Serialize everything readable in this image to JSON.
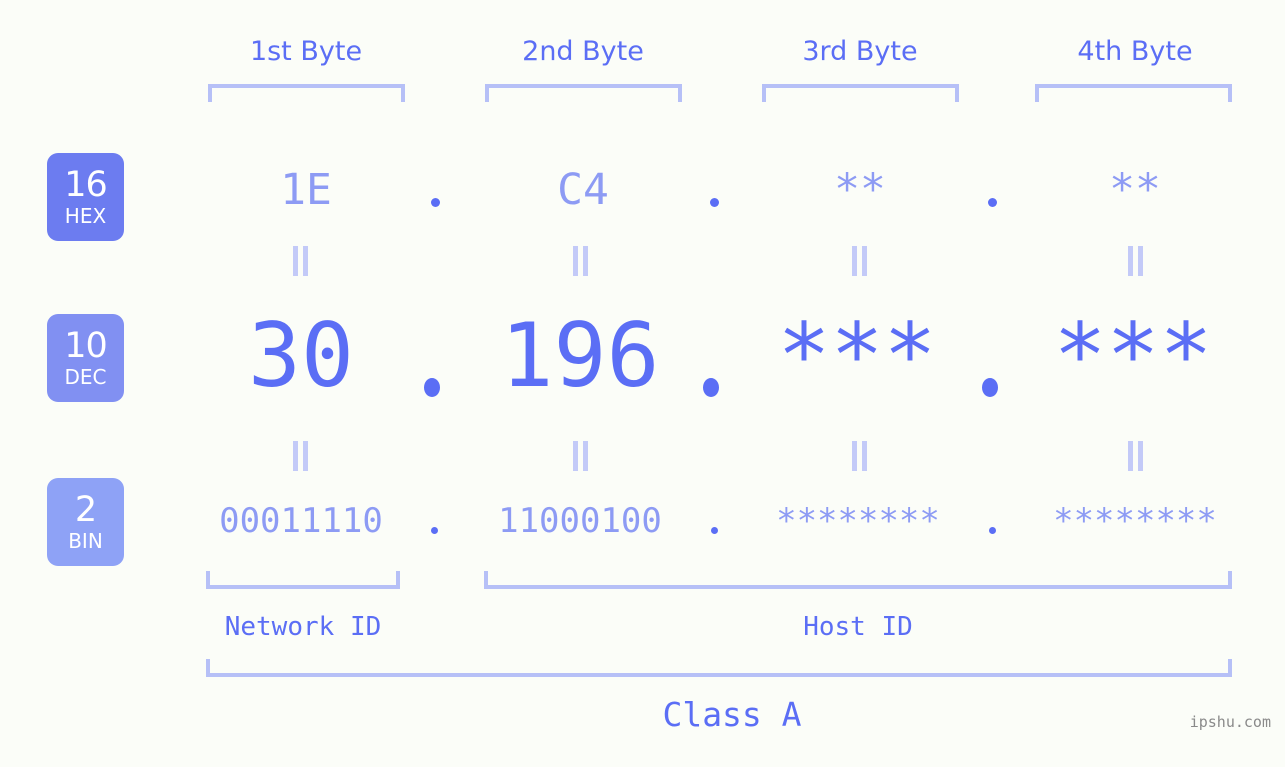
{
  "page": {
    "background_color": "#fbfdf8",
    "accent_color": "#5b6ef5",
    "muted_accent_color": "#8d9bf4",
    "bracket_color": "#b6c0f7",
    "watermark": "ipshu.com"
  },
  "byte_headers": [
    {
      "label": "1st Byte"
    },
    {
      "label": "2nd Byte"
    },
    {
      "label": "3rd Byte"
    },
    {
      "label": "4th Byte"
    }
  ],
  "rows": [
    {
      "badge": {
        "number": "16",
        "name": "HEX",
        "color": "#6c7cf0"
      },
      "values": [
        "1E",
        "C4",
        "**",
        "**"
      ],
      "separators": [
        ".",
        ".",
        "."
      ]
    },
    {
      "badge": {
        "number": "10",
        "name": "DEC",
        "color": "#8190f2"
      },
      "values": [
        "30",
        "196",
        "***",
        "***"
      ],
      "separators": [
        ".",
        ".",
        "."
      ]
    },
    {
      "badge": {
        "number": "2",
        "name": "BIN",
        "color": "#8ea2f6"
      },
      "values": [
        "00011110",
        "11000100",
        "********",
        "********"
      ],
      "separators": [
        ".",
        ".",
        "."
      ]
    }
  ],
  "equivalence_symbol": "||",
  "id_labels": [
    {
      "label": "Network ID"
    },
    {
      "label": "Host ID"
    }
  ],
  "class_label": "Class A"
}
